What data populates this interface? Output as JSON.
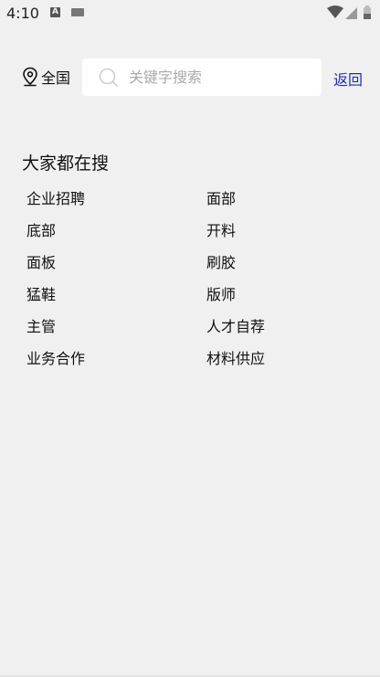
{
  "status_bar": {
    "time": "4:10",
    "a_badge": "A",
    "icons": [
      "keyboard-icon",
      "wifi-icon",
      "signal-icon",
      "battery-icon"
    ]
  },
  "header": {
    "location_label": "全国",
    "search_placeholder": "关键字搜索",
    "search_value": "",
    "back_label": "返回"
  },
  "hot": {
    "title": "大家都在搜",
    "items": [
      "企业招聘",
      "面部",
      "底部",
      "开料",
      "面板",
      "刷胶",
      "猛鞋",
      "版师",
      "主管",
      "人才自荐",
      "业务合作",
      "材料供应"
    ]
  },
  "colors": {
    "background": "#f0f0f0",
    "accent": "#1a2ec8",
    "placeholder": "#aaaaaa"
  }
}
